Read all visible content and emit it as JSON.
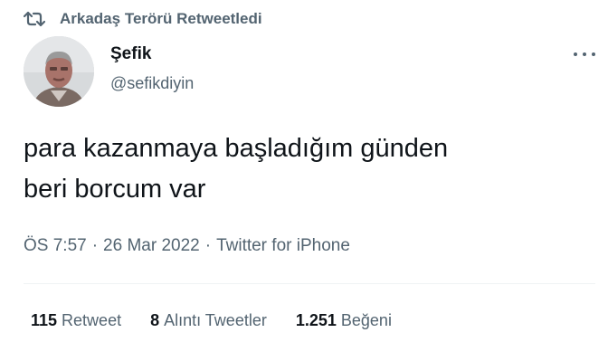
{
  "social_context": {
    "icon": "retweet-icon",
    "text": "Arkadaş Terörü Retweetledi"
  },
  "author": {
    "avatar": "avatar",
    "display_name": "Şefik",
    "handle": "@sefikdiyin"
  },
  "more_menu": {
    "icon": "more-icon"
  },
  "tweet": {
    "text": "para kazanmaya başladığım günden\nberi borcum var",
    "time": "ÖS 7:57",
    "separator": "·",
    "date": "26 Mar 2022",
    "source": "Twitter for iPhone"
  },
  "stats": [
    {
      "value": "115",
      "label": "Retweet"
    },
    {
      "value": "8",
      "label": "Alıntı Tweetler"
    },
    {
      "value": "1.251",
      "label": "Beğeni"
    }
  ],
  "colors": {
    "text_primary": "#0f1419",
    "text_secondary": "#536471",
    "divider": "#eff3f4"
  }
}
